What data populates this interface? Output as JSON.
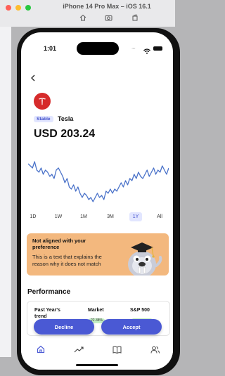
{
  "simulator": {
    "title": "iPhone 14 Pro Max – iOS 16.1",
    "tools": [
      "home-icon",
      "screenshot-icon",
      "rotate-icon"
    ]
  },
  "status_bar": {
    "time": "1:01",
    "signal": "....",
    "battery": "full"
  },
  "header": {
    "back_icon": "chevron-left-icon",
    "logo_icon": "tesla-logo-icon",
    "tag": "Stable",
    "ticker": "Tesla",
    "price": "USD 203.24"
  },
  "colors": {
    "accent": "#4a59d4",
    "tag_bg": "#e2e6ff",
    "card_bg": "#f3b87e",
    "line": "#4a72c9",
    "logo": "#d62b2b"
  },
  "chart_data": {
    "type": "line",
    "title": "",
    "xlabel": "",
    "ylabel": "",
    "series": [
      {
        "values": [
          62,
          60,
          58,
          64,
          56,
          54,
          58,
          52,
          56,
          54,
          50,
          52,
          48,
          56,
          58,
          54,
          50,
          44,
          48,
          40,
          38,
          42,
          36,
          40,
          34,
          30,
          34,
          32,
          28,
          30,
          26,
          30,
          34,
          30,
          32,
          28,
          36,
          34,
          38,
          34,
          38,
          36,
          40,
          44,
          40,
          46,
          42,
          48,
          46,
          52,
          48,
          54,
          50,
          48,
          52,
          56,
          50,
          54,
          58,
          52,
          56,
          54,
          60,
          56,
          52,
          58
        ]
      }
    ]
  },
  "ranges": [
    "1D",
    "1W",
    "1M",
    "3M",
    "1Y",
    "All"
  ],
  "active_range": "1Y",
  "alignment_card": {
    "title": "Not aligned with your preference",
    "body": "This is a text that explains the reason why it does not match",
    "mascot_icon": "walrus-graduate-icon"
  },
  "performance": {
    "title": "Performance",
    "headers": [
      "Past Year's trend",
      "Market",
      "S&P 500"
    ],
    "market_value": "22.38%"
  },
  "actions": {
    "decline": "Decline",
    "accept": "Accept"
  },
  "tabs": [
    {
      "name": "home",
      "icon": "home-icon",
      "active": true
    },
    {
      "name": "trends",
      "icon": "trend-icon",
      "active": false
    },
    {
      "name": "learn",
      "icon": "book-icon",
      "active": false
    },
    {
      "name": "community",
      "icon": "people-icon",
      "active": false
    }
  ]
}
